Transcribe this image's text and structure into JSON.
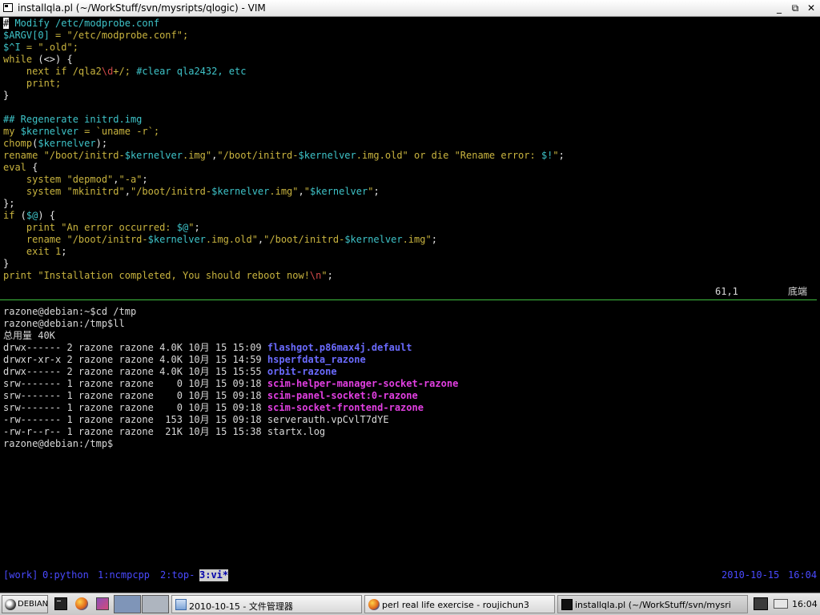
{
  "window": {
    "title": "installqla.pl (~/WorkStuff/svn/mysripts/qlogic) - VIM",
    "btn_min": "_",
    "btn_max": "⧉",
    "btn_close": "✕"
  },
  "editor": {
    "cursor_char": "#",
    "lines": {
      "l1": " Modify /etc/modprobe.conf",
      "l2a": "$ARGV[0]",
      "l2b": " = ",
      "l2c": "\"/etc/modprobe.conf\"",
      "l2d": ";",
      "l3a": "$^I",
      "l3b": " = ",
      "l3c": "\".old\"",
      "l3d": ";",
      "l4a": "while",
      "l4b": " (<>) {",
      "l5a": "    next ",
      "l5b": "if",
      "l5c": " /qla2",
      "l5d": "\\d",
      "l5e": "+/; ",
      "l5f": "#clear qla2432, etc",
      "l6a": "    print",
      "l6b": ";",
      "l7": "}",
      "l9": "## Regenerate initrd.img",
      "l10a": "my ",
      "l10b": "$kernelver",
      "l10c": " = ",
      "l10d": "`uname -r`",
      "l10e": ";",
      "l11a": "chomp",
      "l11b": "(",
      "l11c": "$kernelver",
      "l11d": ");",
      "l12a": "rename ",
      "l12b": "\"/boot/initrd-",
      "l12c": "$kernelver",
      "l12d": ".img\"",
      "l12e": ",",
      "l12f": "\"/boot/initrd-",
      "l12g": "$kernelver",
      "l12h": ".img.old\"",
      "l12i": " or die ",
      "l12j": "\"Rename error: ",
      "l12k": "$!",
      "l12l": "\"",
      "l12m": ";",
      "l13a": "eval",
      "l13b": " {",
      "l14a": "    system ",
      "l14b": "\"depmod\"",
      "l14c": ",",
      "l14d": "\"-a\"",
      "l14e": ";",
      "l15a": "    system ",
      "l15b": "\"mkinitrd\"",
      "l15c": ",",
      "l15d": "\"/boot/initrd-",
      "l15e": "$kernelver",
      "l15f": ".img\"",
      "l15g": ",",
      "l15h": "\"",
      "l15i": "$kernelver",
      "l15j": "\"",
      "l15k": ";",
      "l16": "};",
      "l17a": "if",
      "l17b": " (",
      "l17c": "$@",
      "l17d": ") {",
      "l18a": "    print ",
      "l18b": "\"An error occurred: ",
      "l18c": "$@",
      "l18d": "\"",
      "l18e": ";",
      "l19a": "    rename ",
      "l19b": "\"/boot/initrd-",
      "l19c": "$kernelver",
      "l19d": ".img.old\"",
      "l19e": ",",
      "l19f": "\"/boot/initrd-",
      "l19g": "$kernelver",
      "l19h": ".img\"",
      "l19i": ";",
      "l20a": "    exit ",
      "l20b": "1",
      "l20c": ";",
      "l21": "}",
      "l22a": "print ",
      "l22b": "\"Installation completed, You should reboot now!",
      "l22c": "\\n",
      "l22d": "\"",
      "l22e": ";"
    },
    "status_position": "61,1",
    "status_where": "底端"
  },
  "shell": {
    "line1": "razone@debian:~$cd /tmp",
    "line2": "razone@debian:/tmp$ll",
    "total": "总用量 40K",
    "rows": [
      {
        "meta": "drwx------ 2 razone razone 4.0K 10月 15 15:09 ",
        "name": "flashgot.p86max4j.default"
      },
      {
        "meta": "drwxr-xr-x 2 razone razone 4.0K 10月 15 14:59 ",
        "name": "hsperfdata_razone"
      },
      {
        "meta": "drwx------ 2 razone razone 4.0K 10月 15 15:55 ",
        "name": "orbit-razone"
      },
      {
        "meta": "srw------- 1 razone razone    0 10月 15 09:18 ",
        "name": "scim-helper-manager-socket-razone"
      },
      {
        "meta": "srw------- 1 razone razone    0 10月 15 09:18 ",
        "name": "scim-panel-socket:0-razone"
      },
      {
        "meta": "srw------- 1 razone razone    0 10月 15 09:18 ",
        "name": "scim-socket-frontend-razone"
      },
      {
        "meta": "-rw------- 1 razone razone  153 10月 15 09:18 ",
        "name": "serverauth.vpCvlT7dYE"
      },
      {
        "meta": "-rw-r--r-- 1 razone razone  21K 10月 15 15:38 ",
        "name": "startx.log"
      }
    ],
    "prompt": "razone@debian:/tmp$"
  },
  "screenbar": {
    "session": "[work]",
    "win0": "0:python",
    "win1": "1:ncmpcpp",
    "win2": "2:top-",
    "win3": "3:vi*",
    "date": "2010-10-15",
    "time": "16:04"
  },
  "taskbar": {
    "start_label": "DEBIAN",
    "tasks": [
      {
        "label": "2010-10-15 - 文件管理器"
      },
      {
        "label": "perl real life exercise - roujichun3"
      },
      {
        "label": "installqla.pl (~/WorkStuff/svn/mysri"
      }
    ],
    "clock": "16:04"
  },
  "colors": {
    "string": "#c9b43f",
    "keyword": "#c9b43f",
    "variable": "#3ec3c8",
    "comment": "#3ec3c8",
    "directory": "#6b6bff",
    "socket": "#e23fe2"
  }
}
